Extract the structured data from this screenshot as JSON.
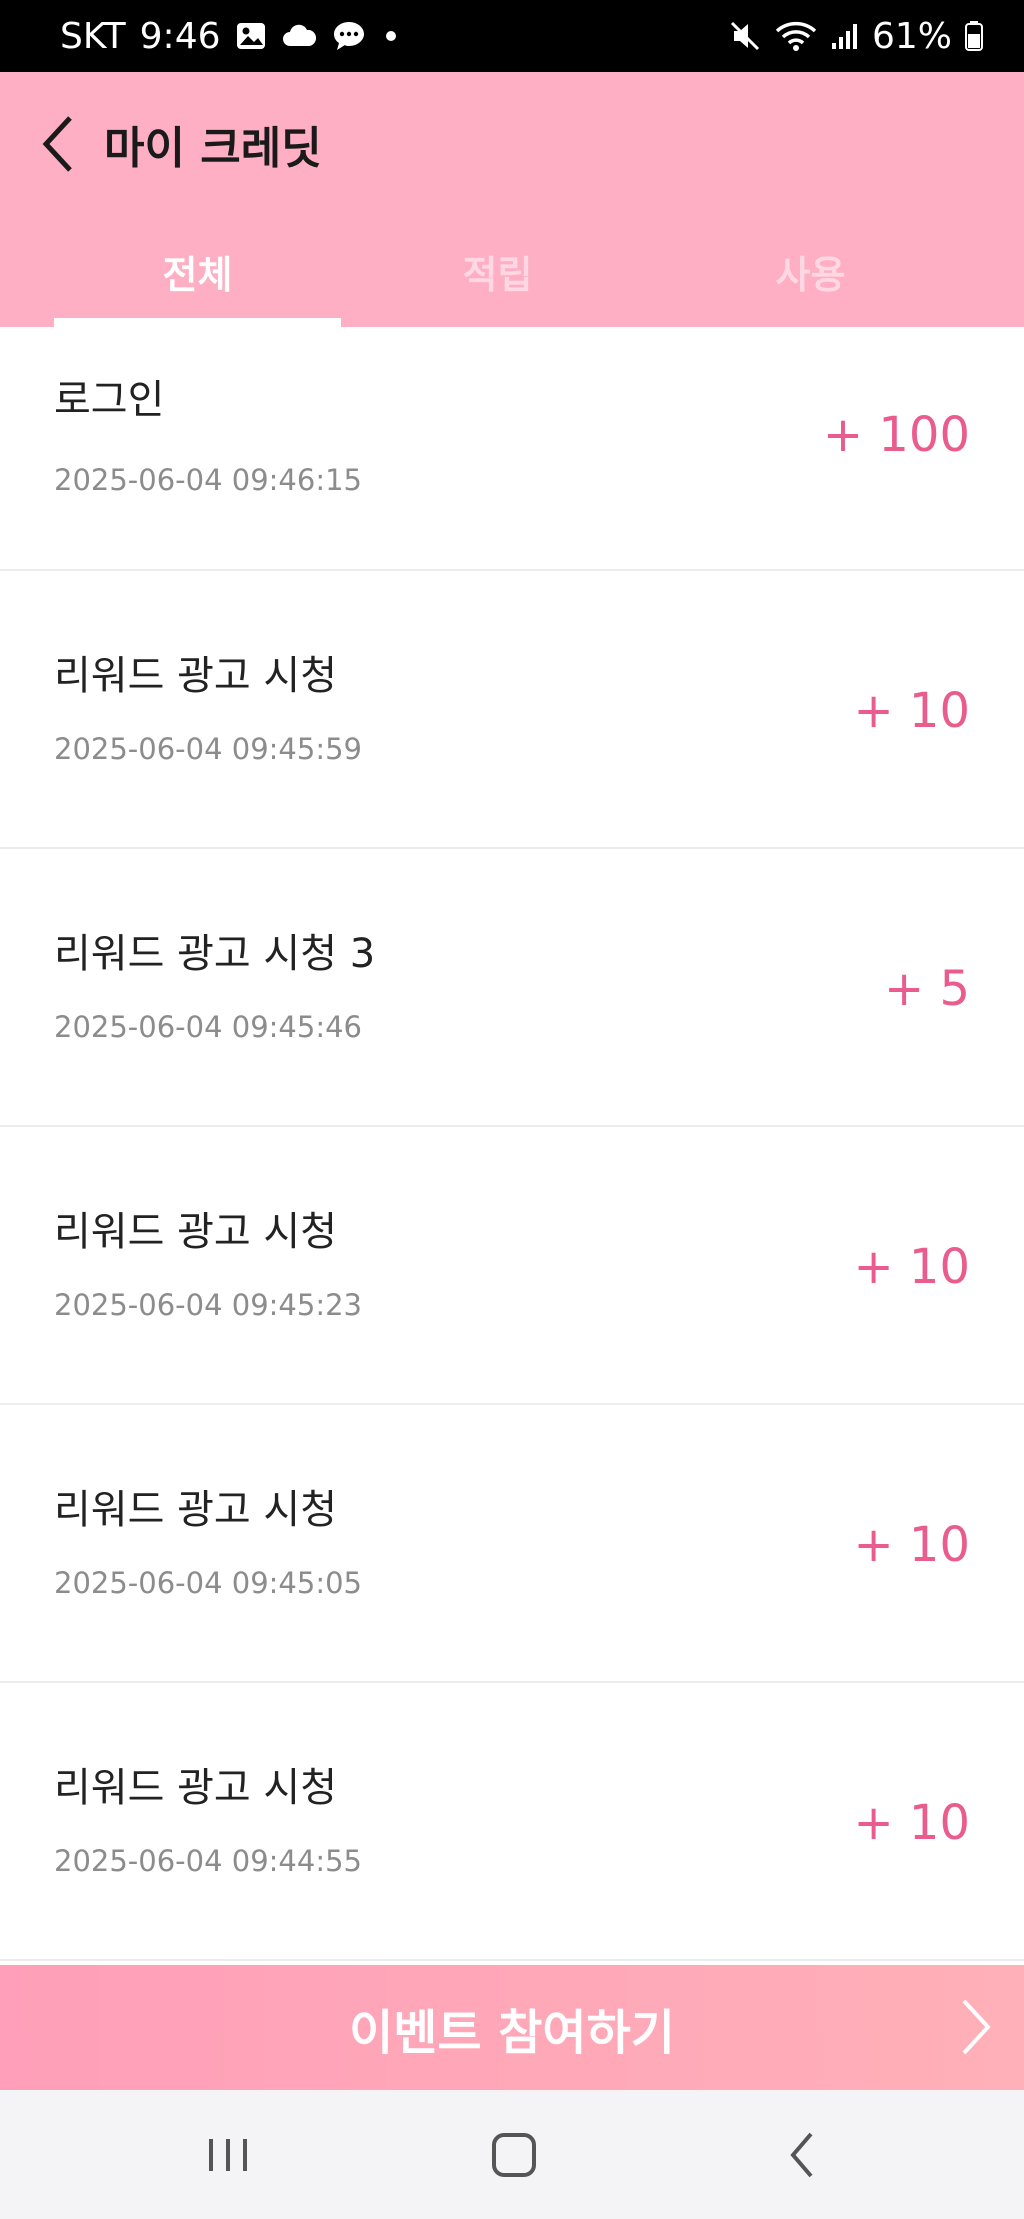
{
  "status_bar": {
    "carrier": "SKT",
    "time": "9:46",
    "battery": "61%",
    "left_icons": [
      "gallery-icon",
      "cloud-icon",
      "chat-icon",
      "dot-icon"
    ],
    "right_icons": [
      "mute-icon",
      "wifi-icon",
      "signal-icon",
      "battery-icon"
    ]
  },
  "header": {
    "title": "마이 크레딧",
    "tabs": [
      {
        "label": "전체",
        "active": true
      },
      {
        "label": "적립",
        "active": false
      },
      {
        "label": "사용",
        "active": false
      }
    ]
  },
  "colors": {
    "header_bg": "#ffafc4",
    "amount": "#ea5c8d",
    "banner": "#ff9fb9"
  },
  "credits": [
    {
      "label": "로그인",
      "date": "2025-06-04 09:46:15",
      "amount": "+ 100"
    },
    {
      "label": "리워드 광고 시청",
      "date": "2025-06-04 09:45:59",
      "amount": "+ 10"
    },
    {
      "label": "리워드 광고 시청 3",
      "date": "2025-06-04 09:45:46",
      "amount": "+ 5"
    },
    {
      "label": "리워드 광고 시청",
      "date": "2025-06-04 09:45:23",
      "amount": "+ 10"
    },
    {
      "label": "리워드 광고 시청",
      "date": "2025-06-04 09:45:05",
      "amount": "+ 10"
    },
    {
      "label": "리워드 광고 시청",
      "date": "2025-06-04 09:44:55",
      "amount": "+ 10"
    }
  ],
  "event_banner": {
    "label": "이벤트 참여하기"
  }
}
